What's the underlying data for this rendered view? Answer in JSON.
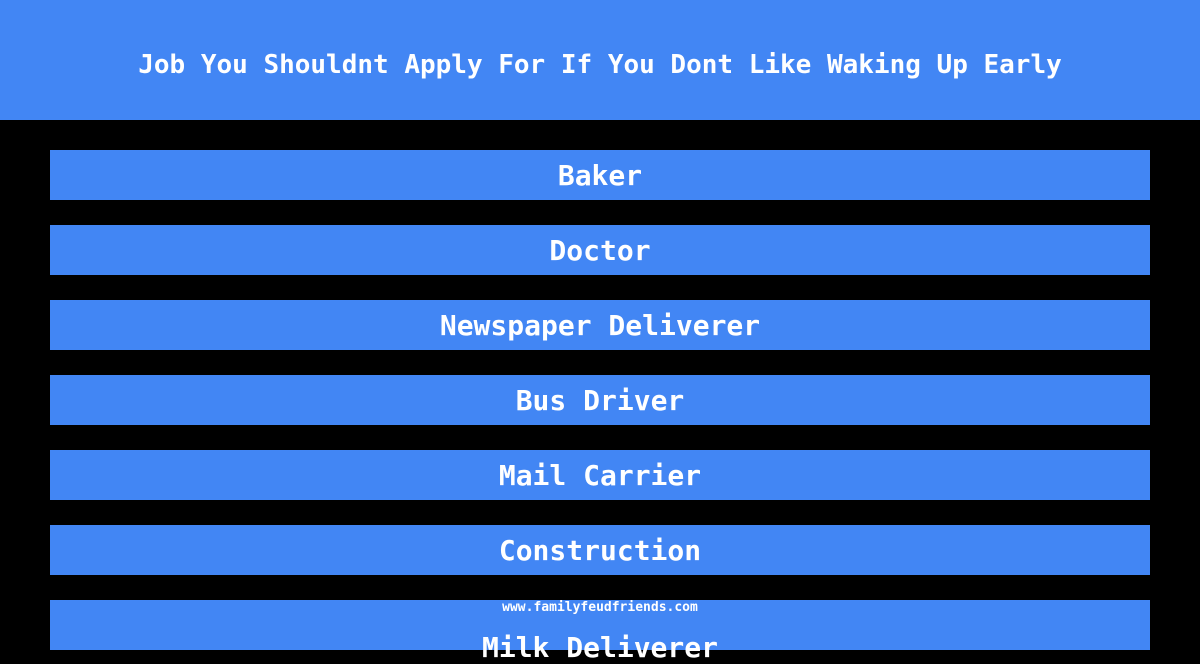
{
  "header": {
    "title": "Job You Shouldnt Apply For If You Dont Like Waking Up Early"
  },
  "answers": [
    {
      "label": "Baker"
    },
    {
      "label": "Doctor"
    },
    {
      "label": "Newspaper Deliverer"
    },
    {
      "label": "Bus Driver"
    },
    {
      "label": "Mail Carrier"
    },
    {
      "label": "Construction"
    },
    {
      "label": "Milk Deliverer"
    }
  ],
  "footer": {
    "watermark": "www.familyfeudfriends.com"
  },
  "colors": {
    "accent": "#4286f4",
    "background": "#000000",
    "text": "#ffffff"
  }
}
